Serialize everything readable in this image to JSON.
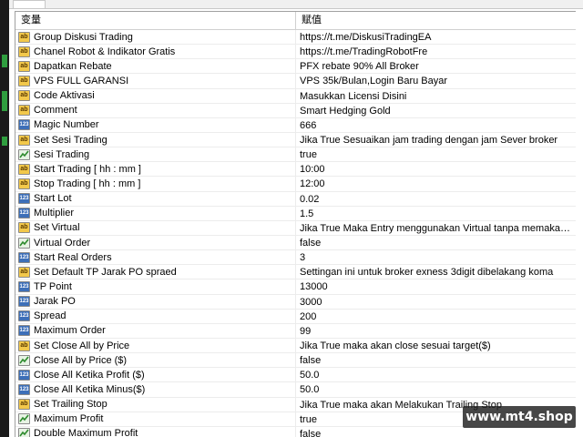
{
  "columns": {
    "name": "变量",
    "value": "赋值"
  },
  "rows": [
    {
      "type": "ab",
      "name": "Group Diskusi Trading",
      "value": "https://t.me/DiskusiTradingEA"
    },
    {
      "type": "ab",
      "name": "Chanel Robot & Indikator Gratis",
      "value": "https://t.me/TradingRobotFre"
    },
    {
      "type": "ab",
      "name": "Dapatkan Rebate",
      "value": "PFX rebate 90% All Broker"
    },
    {
      "type": "ab",
      "name": "VPS FULL GARANSI",
      "value": "VPS 35k/Bulan,Login Baru Bayar"
    },
    {
      "type": "ab",
      "name": "Code Aktivasi",
      "value": "Masukkan Licensi Disini"
    },
    {
      "type": "ab",
      "name": "Comment",
      "value": "Smart Hedging Gold"
    },
    {
      "type": "123",
      "name": "Magic Number",
      "value": "666"
    },
    {
      "type": "ab",
      "name": "Set Sesi Trading",
      "value": "Jika True Sesuaikan jam trading dengan jam Sever broker"
    },
    {
      "type": "bool",
      "name": "Sesi Trading",
      "value": "true"
    },
    {
      "type": "ab",
      "name": "Start Trading [ hh : mm ]",
      "value": "10:00"
    },
    {
      "type": "ab",
      "name": "Stop Trading [ hh : mm ]",
      "value": "12:00"
    },
    {
      "type": "123",
      "name": "Start Lot",
      "value": "0.02"
    },
    {
      "type": "123",
      "name": "Multiplier",
      "value": "1.5"
    },
    {
      "type": "ab",
      "name": "Set Virtual",
      "value": "Jika True Maka Entry menggunakan Virtual tanpa memakan equit..."
    },
    {
      "type": "bool",
      "name": "Virtual Order",
      "value": "false"
    },
    {
      "type": "123",
      "name": "Start Real Orders",
      "value": "3"
    },
    {
      "type": "ab",
      "name": "Set Default TP Jarak PO spraed",
      "value": "Settingan ini untuk broker exness 3digit dibelakang koma"
    },
    {
      "type": "123",
      "name": "TP Point",
      "value": "13000"
    },
    {
      "type": "123",
      "name": "Jarak PO",
      "value": "3000"
    },
    {
      "type": "123",
      "name": "Spread",
      "value": "200"
    },
    {
      "type": "123",
      "name": "Maximum Order",
      "value": "99"
    },
    {
      "type": "ab",
      "name": "Set Close All by Price",
      "value": "Jika True maka akan close sesuai target($)"
    },
    {
      "type": "bool",
      "name": "Close All by Price ($)",
      "value": "false"
    },
    {
      "type": "123",
      "name": "Close All Ketika Profit ($)",
      "value": "50.0"
    },
    {
      "type": "123",
      "name": "Close All Ketika Minus($)",
      "value": "50.0"
    },
    {
      "type": "ab",
      "name": "Set Trailing Stop",
      "value": "Jika True maka akan Melakukan Trailing Stop"
    },
    {
      "type": "bool",
      "name": "Maximum Profit",
      "value": "true"
    },
    {
      "type": "bool",
      "name": "Double Maximum Profit",
      "value": "false"
    }
  ],
  "icon_labels": {
    "ab": "ab",
    "123": "123"
  },
  "watermark": "www.mt4.shop"
}
